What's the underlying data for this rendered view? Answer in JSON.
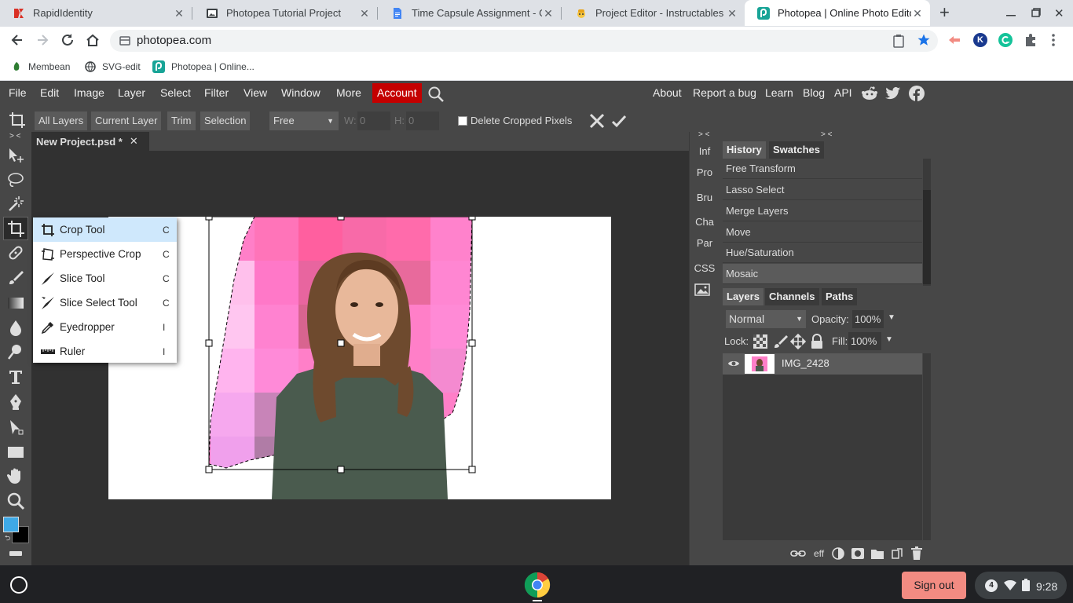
{
  "browser": {
    "tabs": [
      {
        "title": "RapidIdentity",
        "icon": "rapididentity-icon",
        "active": false
      },
      {
        "title": "Photopea Tutorial Project",
        "icon": "document-icon",
        "active": false
      },
      {
        "title": "Time Capsule Assignment - Goo",
        "icon": "google-docs-icon",
        "active": false
      },
      {
        "title": "Project Editor - Instructables",
        "icon": "instructables-icon",
        "active": false
      },
      {
        "title": "Photopea | Online Photo Editor",
        "icon": "photopea-icon",
        "active": true
      }
    ],
    "new_tab": "+",
    "url": "photopea.com",
    "bookmarks": [
      {
        "label": "Membean",
        "icon": "membean-icon"
      },
      {
        "label": "SVG-edit",
        "icon": "globe-icon"
      },
      {
        "label": "Photopea | Online...",
        "icon": "photopea-icon"
      }
    ],
    "profile_initial": "K"
  },
  "photopea": {
    "menu": [
      "File",
      "Edit",
      "Image",
      "Layer",
      "Select",
      "Filter",
      "View",
      "Window",
      "More"
    ],
    "account": "Account",
    "links": [
      "About",
      "Report a bug",
      "Learn",
      "Blog",
      "API"
    ],
    "options": {
      "buttons": [
        "All Layers",
        "Current Layer",
        "Trim",
        "Selection"
      ],
      "ratio": "Free",
      "w_label": "W:",
      "w_value": "0",
      "h_label": "H:",
      "h_value": "0",
      "delete_cropped": "Delete Cropped Pixels"
    },
    "panel_toggle": "> <",
    "doc_tab": "New Project.psd *",
    "tool_menu": [
      {
        "label": "Crop Tool",
        "shortcut": "C",
        "icon": "crop-icon",
        "selected": true
      },
      {
        "label": "Perspective Crop",
        "shortcut": "C",
        "icon": "perspective-crop-icon"
      },
      {
        "label": "Slice Tool",
        "shortcut": "C",
        "icon": "slice-icon"
      },
      {
        "label": "Slice Select Tool",
        "shortcut": "C",
        "icon": "slice-select-icon"
      },
      {
        "label": "Eyedropper",
        "shortcut": "I",
        "icon": "eyedropper-icon"
      },
      {
        "label": "Ruler",
        "shortcut": "I",
        "icon": "ruler-icon"
      }
    ],
    "mini_panels": [
      "Inf",
      "Pro",
      "Bru",
      "Cha",
      "Par",
      "CSS"
    ],
    "history_tabs": [
      "History",
      "Swatches"
    ],
    "history": [
      "Free Transform",
      "Lasso Select",
      "Merge Layers",
      "Move",
      "Hue/Saturation",
      "Mosaic"
    ],
    "layer_tabs": [
      "Layers",
      "Channels",
      "Paths"
    ],
    "blend_mode": "Normal",
    "opacity_label": "Opacity:",
    "opacity": "100%",
    "lock_label": "Lock:",
    "fill_label": "Fill:",
    "fill": "100%",
    "layers": [
      {
        "name": "IMG_2428",
        "visible": true
      }
    ],
    "layer_footer": {
      "eff": "eff"
    },
    "foreground_color": "#3fa9e6",
    "background_color": "#000000"
  },
  "shelf": {
    "sign_out": "Sign out",
    "notifications": "4",
    "time": "9:28"
  }
}
